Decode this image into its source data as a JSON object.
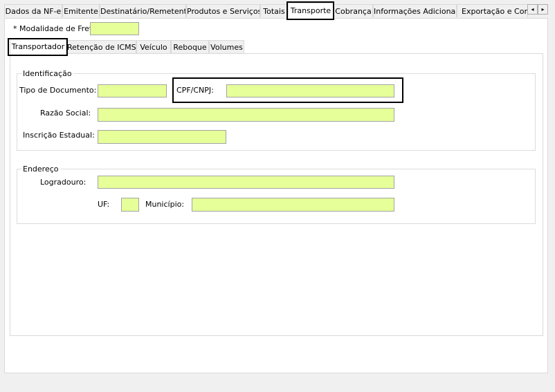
{
  "main_tabs": [
    "Dados da NF-e",
    "Emitente",
    "Destinatário/Remetente",
    "Produtos e Serviços",
    "Totais",
    "Transporte",
    "Cobrança",
    "Informações Adicionais",
    "Exportação e Compr"
  ],
  "active_main_tab": "Transporte",
  "scroll_left_glyph": "◂",
  "scroll_right_glyph": "▸",
  "modalidade": {
    "label": "* Modalidade de Frete:",
    "value": ""
  },
  "sub_tabs": [
    "Transportador",
    "Retenção de ICMS",
    "Veículo",
    "Reboque",
    "Volumes"
  ],
  "active_sub_tab": "Transportador",
  "identificacao": {
    "title": "Identificação",
    "tipo_documento": {
      "label": "Tipo de Documento:",
      "value": ""
    },
    "cpf_cnpj": {
      "label": "CPF/CNPJ:",
      "value": ""
    },
    "razao_social": {
      "label": "Razão Social:",
      "value": ""
    },
    "inscricao_estadual": {
      "label": "Inscrição Estadual:",
      "value": ""
    }
  },
  "endereco": {
    "title": "Endereço",
    "logradouro": {
      "label": "Logradouro:",
      "value": ""
    },
    "uf": {
      "label": "UF:",
      "value": ""
    },
    "municipio": {
      "label": "Município:",
      "value": ""
    }
  },
  "colors": {
    "field_background": "#e6ff99",
    "window_background": "#f0f0f0",
    "highlight_border": "#000000"
  }
}
